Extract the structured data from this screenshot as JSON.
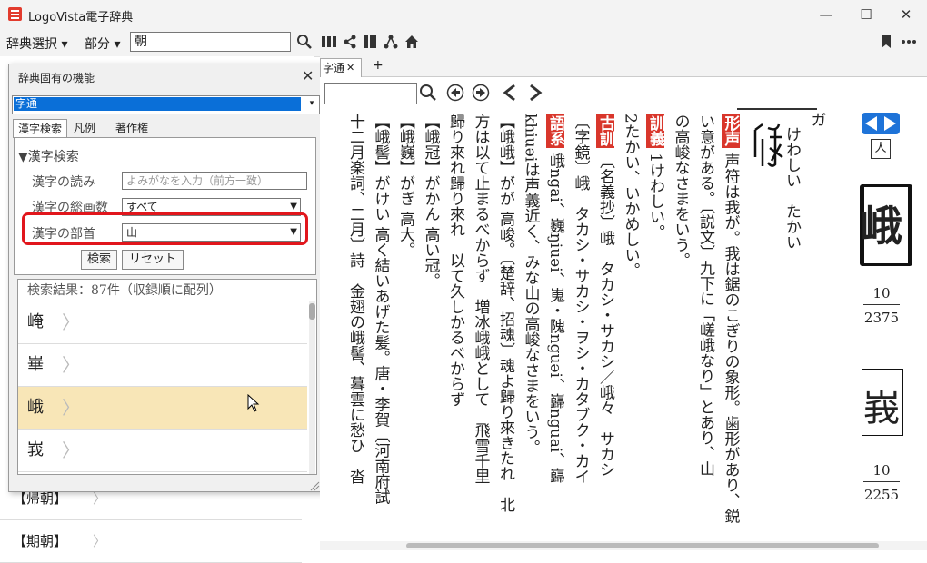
{
  "window": {
    "title": "LogoVista電子辞典",
    "minimize": "—",
    "maximize": "☐",
    "close": "✕"
  },
  "toolbar": {
    "dict_select": "辞典選択 ▾",
    "part_select": "部分 ▾",
    "search_value": "朝"
  },
  "left_list": {
    "items": [
      "【帰朝】",
      "【期朝】"
    ],
    "chevron": "〉"
  },
  "panel": {
    "title": "辞典固有の機能",
    "close": "✕",
    "dictionary": "字通",
    "tabs": [
      "漢字検索",
      "凡例",
      "著作権"
    ],
    "group_title": "▼漢字検索",
    "reading_label": "漢字の読み",
    "reading_placeholder": "よみがなを入力（前方一致）",
    "strokes_label": "漢字の総画数",
    "strokes_value": "すべて",
    "radical_label": "漢字の部首",
    "radical_value": "山",
    "search_button": "検索",
    "reset_button": "リセット",
    "results_header": "検索結果：87件（収録順に配列）",
    "results": [
      "崦",
      "崋",
      "峨",
      "峩"
    ],
    "chevron": "〉"
  },
  "tabs": {
    "main_tab": "字通",
    "add": "+"
  },
  "content": {
    "columns": [
      "ガ",
      "けわしい　たかい",
      "",
      "形声 声符は我が。我は鋸のこぎりの象形。歯形があり、鋭",
      "い意がある。〔説文〕九下に「嵯峨なり」とあり、山",
      "の高峻なさまをいう。",
      "訓義 1けわしい。",
      "2たかい、いかめしい。",
      "古訓 〔名義抄〕峨　タカシ・サカシ／峨々　サカシ",
      "〔字鏡〕峨　タカシ・サカシ・ヲシ・カタブク・カイ",
      "語系 峨ngai、巍ŋiuəi、嵬・隗nguəi、巋nguai、巋",
      "khiuəiは声義近く、みな山の高峻なさまをいう。",
      "【峨峨】がが 高峻。〔楚辞、招魂〕魂よ歸り來きたれ　北",
      "方は以て止まるべからず　増冰峨峨として　飛雪千里",
      "歸り來れ歸り來れ　以て久しかるべからず",
      "【峨冠】がかん 高い冠。",
      "【峨巍】がぎ 高大。",
      "【峨髻】がけい 高く結いあげた髪。唐・李賀〔河南府試",
      "十二月楽詞、二月〕詩　金翅の峨髻、暮雲に愁ひ　沓"
    ]
  },
  "entry": {
    "radical": "人",
    "kanji1": "峨",
    "strokes1": "10",
    "code1": "2375",
    "kanji2": "峩",
    "strokes2": "10",
    "code2": "2255"
  }
}
